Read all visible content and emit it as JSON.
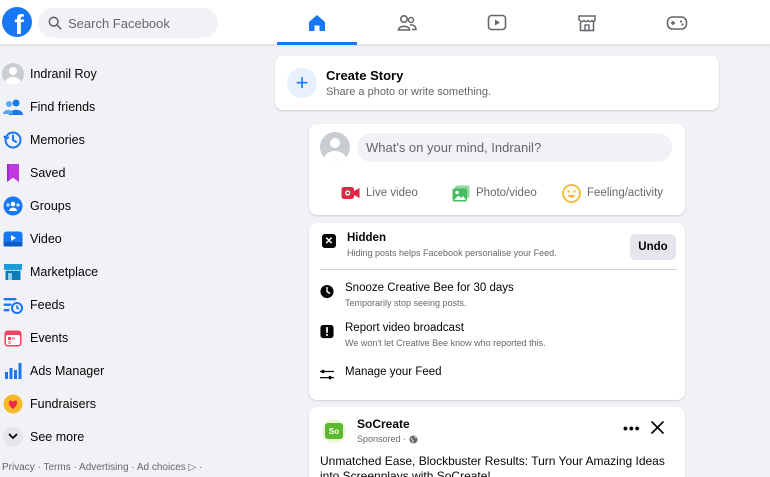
{
  "header": {
    "logo_letter": "f",
    "search_placeholder": "Search Facebook",
    "tabs": [
      {
        "name": "home",
        "icon": "home-icon",
        "active": true
      },
      {
        "name": "friends",
        "icon": "friends-icon",
        "active": false
      },
      {
        "name": "video",
        "icon": "video-icon",
        "active": false
      },
      {
        "name": "marketplace",
        "icon": "marketplace-icon",
        "active": false
      },
      {
        "name": "gaming",
        "icon": "gaming-icon",
        "active": false
      }
    ]
  },
  "sidebar": {
    "items": [
      {
        "label": "Indranil Roy",
        "icon": "avatar"
      },
      {
        "label": "Find friends",
        "icon": "friends-icon"
      },
      {
        "label": "Memories",
        "icon": "memories-icon"
      },
      {
        "label": "Saved",
        "icon": "saved-icon"
      },
      {
        "label": "Groups",
        "icon": "groups-icon"
      },
      {
        "label": "Video",
        "icon": "video-icon"
      },
      {
        "label": "Marketplace",
        "icon": "marketplace-icon"
      },
      {
        "label": "Feeds",
        "icon": "feeds-icon"
      },
      {
        "label": "Events",
        "icon": "events-icon"
      },
      {
        "label": "Ads Manager",
        "icon": "ads-manager-icon"
      },
      {
        "label": "Fundraisers",
        "icon": "fundraisers-icon"
      },
      {
        "label": "See more",
        "icon": "chevron-down-icon"
      }
    ],
    "footer": "Privacy · Terms · Advertising · Ad choices ▷ ·"
  },
  "story": {
    "title": "Create Story",
    "subtitle": "Share a photo or write something.",
    "plus": "+"
  },
  "composer": {
    "placeholder": "What's on your mind, Indranil?",
    "actions": [
      {
        "label": "Live video",
        "icon": "live-video-icon"
      },
      {
        "label": "Photo/video",
        "icon": "photo-icon"
      },
      {
        "label": "Feeling/activity",
        "icon": "feeling-icon"
      }
    ]
  },
  "hidden_post": {
    "title": "Hidden",
    "subtitle": "Hiding posts helps Facebook personalise your Feed.",
    "undo_label": "Undo",
    "options": [
      {
        "title": "Snooze Creative Bee for 30 days",
        "subtitle": "Temporarily stop seeing posts.",
        "icon": "clock-icon"
      },
      {
        "title": "Report video broadcast",
        "subtitle": "We won't let Creative Bee know who reported this.",
        "icon": "report-icon"
      },
      {
        "title": "Manage your Feed",
        "subtitle": "",
        "icon": "sliders-icon"
      }
    ]
  },
  "post": {
    "page_name": "SoCreate",
    "logo_text": "So",
    "meta": "Sponsored ·",
    "text": "Unmatched Ease, Blockbuster Results: Turn Your Amazing Ideas into Screenplays with SoCreate!"
  },
  "colors": {
    "brand": "#1877f2",
    "live": "#e42645",
    "photo": "#45bd62",
    "feeling": "#f7b928"
  }
}
